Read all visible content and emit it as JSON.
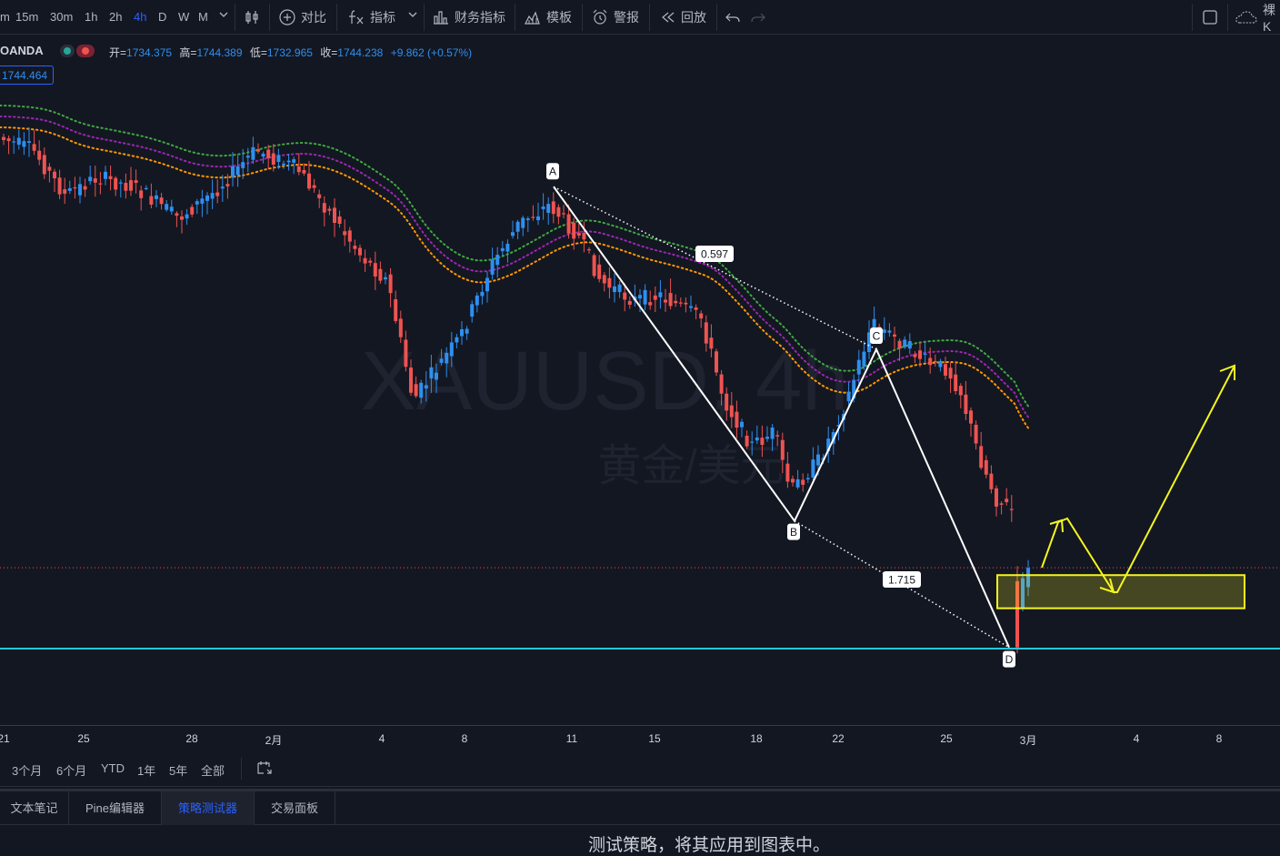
{
  "toolbar": {
    "intervals": [
      "m",
      "15m",
      "30m",
      "1h",
      "2h",
      "4h",
      "D",
      "W",
      "M"
    ],
    "active_interval": "4h",
    "compare": "对比",
    "indicators": "指标",
    "financials": "财务指标",
    "templates": "模板",
    "alert": "警报",
    "replay": "回放",
    "right_label": "裸K"
  },
  "legend": {
    "symbol": "OANDA",
    "open_key": "开=",
    "open": "1734.375",
    "high_key": "高=",
    "high": "1744.389",
    "low_key": "低=",
    "low": "1732.965",
    "close_key": "收=",
    "close": "1744.238",
    "change": "+9.862 (+0.57%)",
    "price_box": "1744.464"
  },
  "colors": {
    "background": "#131722",
    "up": "#2e8ff0",
    "down": "#ef5350",
    "ema_green": "#3fa83f",
    "ema_purple": "#9c27b0",
    "ema_orange": "#ff9800",
    "support_line": "#26c6da",
    "projection": "#f5f51e"
  },
  "chart_data": {
    "type": "candlestick",
    "watermark": "XAUUSD, 4h",
    "watermark_sub": "黄金/美元",
    "x_ticks": [
      "21",
      "25",
      "28",
      "2月",
      "4",
      "8",
      "11",
      "15",
      "18",
      "22",
      "25",
      "3月",
      "4",
      "8"
    ],
    "pattern": {
      "points": [
        {
          "label": "A",
          "price": 1871
        },
        {
          "label": "B",
          "price": 1760
        },
        {
          "label": "C",
          "price": 1817
        },
        {
          "label": "D",
          "price": 1718
        }
      ],
      "ratios": [
        "0.597",
        "1.715"
      ]
    },
    "last_price": 1744.464,
    "support_price": 1717.6,
    "target_zone": {
      "low": 1731,
      "high": 1742
    },
    "ema_ribbon": [
      "green",
      "purple",
      "orange"
    ]
  },
  "ranges": [
    "3个月",
    "6个月",
    "YTD",
    "1年",
    "5年",
    "全部"
  ],
  "tabs": [
    {
      "label": "文本笔记"
    },
    {
      "label": "Pine编辑器"
    },
    {
      "label": "策略测试器",
      "active": true
    },
    {
      "label": "交易面板"
    }
  ],
  "message": "测试策略，将其应用到图表中。"
}
